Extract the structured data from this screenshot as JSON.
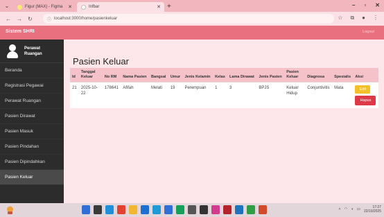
{
  "browser": {
    "tabs": [
      {
        "label": "Figur (MAX) - Figma",
        "active": false,
        "fav_color": "#f8ec6e"
      },
      {
        "label": "Infbar",
        "active": true,
        "fav_color": "#ffffff"
      }
    ],
    "new_tab_icon": "plus",
    "window_controls": [
      "minimize",
      "maximize",
      "close"
    ],
    "url": "localhost:3000/home/pasienkeluar"
  },
  "app": {
    "brand": "Sistem SHRI",
    "logout_label": "Logout"
  },
  "sidebar": {
    "profile_line1": "Perawat",
    "profile_line2": "Ruangan",
    "items": [
      {
        "label": "Beranda",
        "active": false
      },
      {
        "label": "Registrasi Pegawai",
        "active": false
      },
      {
        "label": "Perawat Ruangan",
        "active": false
      },
      {
        "label": "Pasien Dirawat",
        "active": false
      },
      {
        "label": "Pasien Masuk",
        "active": false
      },
      {
        "label": "Pasien Pindahan",
        "active": false
      },
      {
        "label": "Pasien Dipindahkan",
        "active": false
      },
      {
        "label": "Pasien Keluar",
        "active": true
      }
    ]
  },
  "main": {
    "title": "Pasien Keluar",
    "table": {
      "headers": [
        "Id",
        "Tanggal Keluar",
        "No RM",
        "Nama Pasien",
        "Bangsal",
        "Umur",
        "Jenis Kelamin",
        "Kelas",
        "Lama Dirawat",
        "Jenis Pasien",
        "Pasien Keluar",
        "Diagnosa",
        "Spesialis",
        "Aksi"
      ],
      "rows": [
        {
          "id": "21",
          "tanggal": "2025-10-22",
          "no_rm": "178641",
          "nama": "Afifah",
          "bangsal": "Melati",
          "umur": "19",
          "jk": "Perempuan",
          "kelas": "1",
          "lama": "3",
          "jenis_pasien": "BPJS",
          "pasien_keluar": "Keluar Hidup",
          "diagnosa": "Conjuntivitis",
          "spesialis": "Mata"
        }
      ],
      "edit_label": "Edit",
      "hapus_label": "Hapus"
    }
  },
  "taskbar": {
    "icon_colors": [
      "#2f6fd6",
      "#3a3a3a",
      "#1e8fd8",
      "#e0432f",
      "#f2b630",
      "#1d6fd1",
      "#1f9ad6",
      "#2f6fd6",
      "#15a05a",
      "#555555",
      "#333333",
      "#d33b8f",
      "#b4222b",
      "#1e73be",
      "#2f9e44",
      "#d14a2a"
    ],
    "clock_time": "17:27",
    "clock_date": "22/10/2025"
  },
  "colors": {
    "header": "#e9707e",
    "sidebar": "#2c2c2c",
    "edit": "#f3bf2a",
    "hapus": "#dd3a48"
  }
}
